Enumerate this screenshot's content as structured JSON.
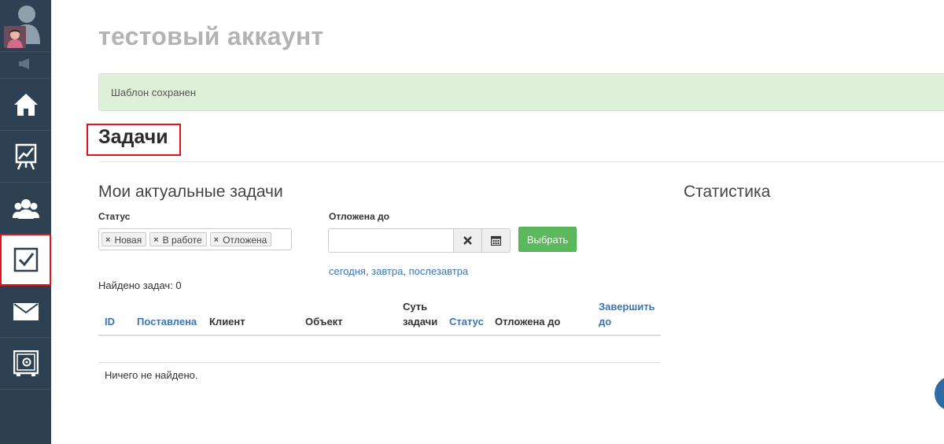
{
  "account": {
    "title": "тестовый аккаунт"
  },
  "alert": {
    "message": "Шаблон сохранен"
  },
  "page": {
    "title": "Задачи"
  },
  "sidebar": {
    "items": [
      {
        "icon": "home-icon",
        "label": ""
      },
      {
        "icon": "chart-easel-icon",
        "label": ""
      },
      {
        "icon": "users-icon",
        "label": ""
      },
      {
        "icon": "tasks-checkbox-icon",
        "label": "",
        "active": true
      },
      {
        "icon": "mail-icon",
        "label": ""
      },
      {
        "icon": "safe-icon",
        "label": ""
      }
    ]
  },
  "tasks": {
    "heading": "Мои актуальные задачи",
    "status_label": "Статус",
    "status_chips": [
      "Новая",
      "В работе",
      "Отложена"
    ],
    "postponed_label": "Отложена до",
    "date_value": "",
    "select_button": "Выбрать",
    "quick_dates": [
      "сегодня",
      "завтра",
      "послезавтра"
    ],
    "quick_sep": ", ",
    "found_text": "Найдено задач: 0",
    "columns": {
      "id": "ID",
      "created": "Поставлена",
      "client": "Клиент",
      "object": "Объект",
      "essence_1": "Суть",
      "essence_2": "задачи",
      "status": "Статус",
      "postponed": "Отложена до",
      "finish_1": "Завершить",
      "finish_2": "до"
    },
    "empty_text": "Ничего не найдено."
  },
  "stats": {
    "heading": "Статистика"
  },
  "colors": {
    "sidebar": "#2d4153",
    "alert_bg": "#dff0d8",
    "link": "#3a76b5",
    "button": "#5cb85c",
    "highlight": "#e0141e"
  }
}
